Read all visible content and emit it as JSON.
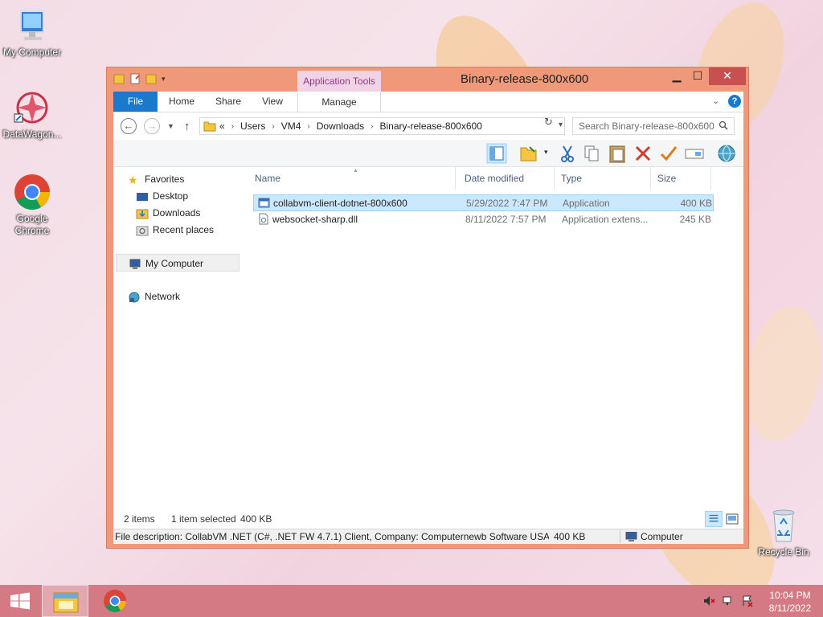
{
  "desktop": {
    "icons": [
      {
        "label": "My Computer"
      },
      {
        "label": "DataWagon..."
      },
      {
        "label": "Google Chrome"
      },
      {
        "label": "Recycle Bin"
      }
    ]
  },
  "window": {
    "title": "Binary-release-800x600",
    "context_tab_group": "Application Tools",
    "buttons": {
      "minimize": "▁",
      "maximize": "☐",
      "close": "✕"
    },
    "ribbon_tabs": [
      "File",
      "Home",
      "Share",
      "View",
      "Manage"
    ],
    "help": "?",
    "ribbon_toggle": "⌄"
  },
  "address_bar": {
    "overflow": "«",
    "crumbs": [
      "Users",
      "VM4",
      "Downloads",
      "Binary-release-800x600"
    ],
    "separator": "›"
  },
  "search": {
    "placeholder": "Search Binary-release-800x600"
  },
  "nav_pane": {
    "favorites": "Favorites",
    "desktop": "Desktop",
    "downloads": "Downloads",
    "recent": "Recent places",
    "computer": "My Computer",
    "network": "Network"
  },
  "columns": {
    "name": "Name",
    "date": "Date modified",
    "type": "Type",
    "size": "Size"
  },
  "files": [
    {
      "name": "collabvm-client-dotnet-800x600",
      "date": "5/29/2022 7:47 PM",
      "type": "Application",
      "size": "400 KB",
      "selected": true
    },
    {
      "name": "websocket-sharp.dll",
      "date": "8/11/2022 7:57 PM",
      "type": "Application extens...",
      "size": "245 KB",
      "selected": false
    }
  ],
  "status": {
    "count": "2 items",
    "selected": "1 item selected",
    "size": "400 KB"
  },
  "details": {
    "description": "File description: CollabVM .NET (C#, .NET FW 4.7.1) Client, Company: Computernewb Software USA, Fil",
    "size": "400 KB",
    "location": "Computer"
  },
  "taskbar": {
    "time": "10:04 PM",
    "date": "8/11/2022"
  },
  "colors": {
    "window_frame": "#f0987a",
    "taskbar": "#d47a84",
    "file_tab": "#1979ca",
    "selection": "#cce8ff",
    "context_tab": "#f2d3e6"
  }
}
